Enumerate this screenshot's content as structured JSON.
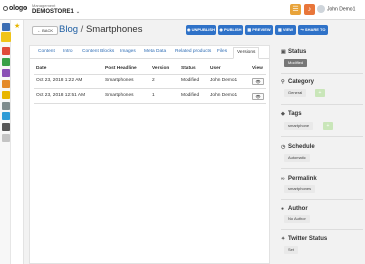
{
  "topbar": {
    "logo": "ologo",
    "section_label": "Management",
    "store_name": "DEMOSTORE1",
    "user_name": "John Demo1"
  },
  "header": {
    "back_label": "← BACK",
    "breadcrumb_parent": "Blog",
    "breadcrumb_sep": "/",
    "breadcrumb_current": "Smartphones",
    "buttons": {
      "unpublish": "◉ UNPUBLISH",
      "publish": "◉ PUBLISH",
      "preview": "▦ PREVIEW",
      "view": "▦ VIEW",
      "share": "↪ SHARE TO"
    }
  },
  "tabs": [
    "Content",
    "Intro",
    "Content Blocks",
    "Images",
    "Meta Data",
    "Related products",
    "Files",
    "Versions"
  ],
  "active_tab": "Versions",
  "versions": {
    "columns": [
      "Date",
      "Post Headline",
      "Version",
      "Status",
      "User",
      "View"
    ],
    "rows": [
      {
        "date": "Oct 23, 2018 1:22 AM",
        "headline": "Smartphones",
        "version": "2",
        "status": "Modified",
        "user": "John Demo1"
      },
      {
        "date": "Oct 23, 2018 12:51 AM",
        "headline": "Smartphones",
        "version": "1",
        "status": "Modified",
        "user": "John Demo1"
      }
    ],
    "view_icon": "👁"
  },
  "right_panel": {
    "status": {
      "title": "Status",
      "value": "Modified"
    },
    "category": {
      "title": "Category",
      "value": "General",
      "add": "+"
    },
    "tags": {
      "title": "Tags",
      "value": "smartphone",
      "add": "+"
    },
    "schedule": {
      "title": "Schedule",
      "value": "Automatic"
    },
    "permalink": {
      "title": "Permalink",
      "value": "smartphones"
    },
    "author": {
      "title": "Author",
      "value": "No Author"
    },
    "twitter": {
      "title": "Twitter Status",
      "value": "Set"
    }
  },
  "colors": {
    "primary_button": "#2f72c8",
    "link": "#1f5fa3",
    "notify": "#e8a33a",
    "bell": "#e8763a"
  }
}
